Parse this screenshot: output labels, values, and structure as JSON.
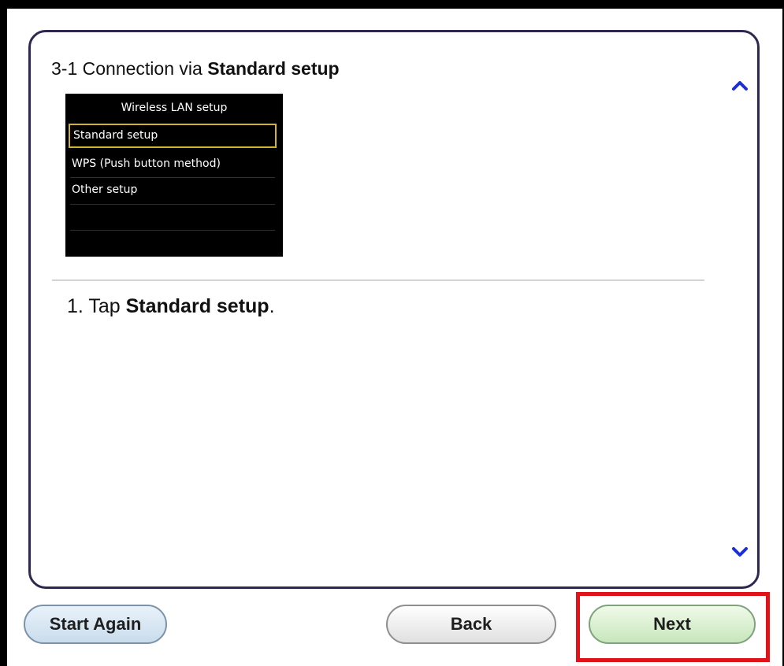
{
  "section": {
    "title_prefix": "3-1 Connection via ",
    "title_bold": "Standard setup"
  },
  "printer_screen": {
    "title": "Wireless LAN setup",
    "items": [
      {
        "label": "Standard setup",
        "selected": true
      },
      {
        "label": "WPS (Push button method)",
        "selected": false
      },
      {
        "label": "Other setup",
        "selected": false
      }
    ],
    "highlight_color": "#d2b32c"
  },
  "instruction": {
    "prefix": "1. Tap ",
    "bold": "Standard setup",
    "suffix": "."
  },
  "scroll": {
    "up_icon": "chevron-up-icon",
    "down_icon": "chevron-down-icon",
    "arrow_color": "#1a2fd9"
  },
  "buttons": {
    "start_again": "Start Again",
    "back": "Back",
    "next": "Next"
  },
  "colors": {
    "panel_border": "#2e2750",
    "highlight_box": "#e0121a"
  }
}
